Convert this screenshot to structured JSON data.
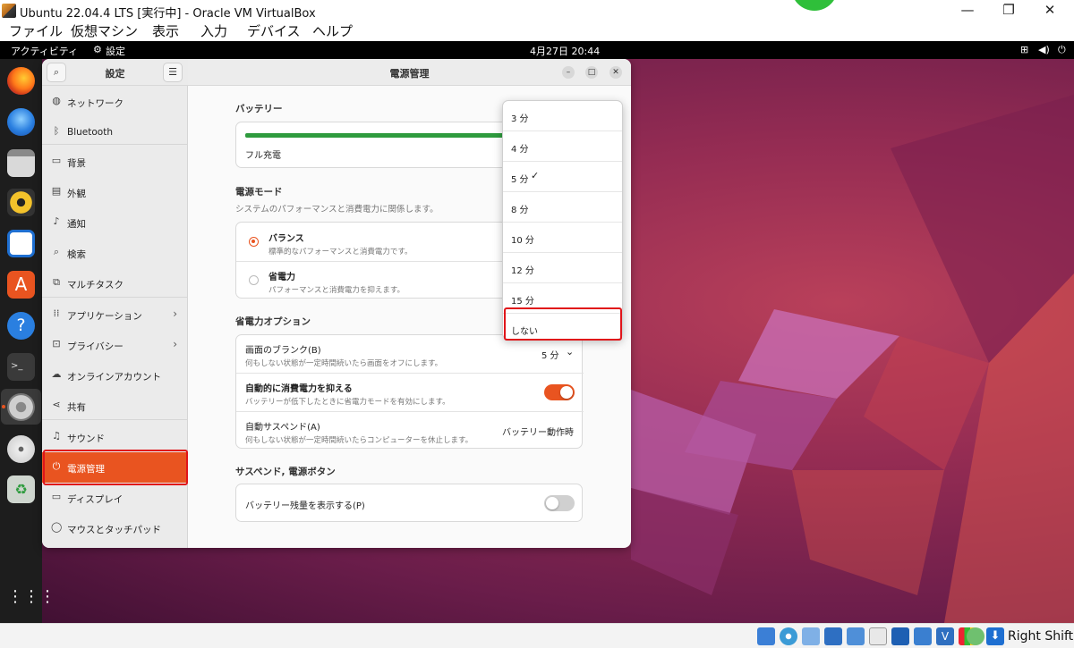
{
  "host": {
    "title": "Ubuntu 22.04.4 LTS [実行中] - Oracle VM VirtualBox",
    "menu": [
      "ファイル",
      "仮想マシン",
      "表示",
      "入力",
      "デバイス",
      "ヘルプ"
    ],
    "host_key": "Right Shift",
    "window_buttons": {
      "minimize": "—",
      "restore": "❐",
      "close": "✕"
    }
  },
  "topbar": {
    "activities": "アクティビティ",
    "app_name": "設定",
    "datetime": "4月27日  20:44",
    "tray_icons": [
      "network-icon",
      "volume-icon",
      "power-icon"
    ]
  },
  "dock": {
    "apps": [
      "firefox-icon",
      "thunderbird-icon",
      "files-icon",
      "rhythmbox-icon",
      "writer-icon",
      "app-center-icon",
      "help-icon",
      "terminal-icon",
      "settings-icon",
      "disc-icon",
      "trash-icon",
      "app-grid-icon"
    ]
  },
  "settings": {
    "sidebar_title": "設定",
    "window_title": "電源管理",
    "sidebar_items": [
      {
        "label": "ネットワーク",
        "icon": "globe-icon"
      },
      {
        "label": "Bluetooth",
        "icon": "bluetooth-icon"
      },
      {
        "label": "背景",
        "icon": "background-icon"
      },
      {
        "label": "外観",
        "icon": "appearance-icon"
      },
      {
        "label": "通知",
        "icon": "bell-icon"
      },
      {
        "label": "検索",
        "icon": "search-icon"
      },
      {
        "label": "マルチタスク",
        "icon": "multitask-icon"
      },
      {
        "label": "アプリケーション",
        "icon": "apps-grid-icon"
      },
      {
        "label": "プライバシー",
        "icon": "lock-icon"
      },
      {
        "label": "オンラインアカウント",
        "icon": "cloud-icon"
      },
      {
        "label": "共有",
        "icon": "share-icon"
      },
      {
        "label": "サウンド",
        "icon": "music-note-icon"
      },
      {
        "label": "電源管理",
        "icon": "power-icon"
      },
      {
        "label": "ディスプレイ",
        "icon": "display-icon"
      },
      {
        "label": "マウスとタッチパッド",
        "icon": "mouse-icon"
      }
    ],
    "battery": {
      "section_title": "バッテリー",
      "status": "フル充電",
      "level": 1.0
    },
    "power_mode": {
      "section_title": "電源モード",
      "subtitle": "システムのパフォーマンスと消費電力に関係します。",
      "options": [
        {
          "title": "バランス",
          "desc": "標準的なパフォーマンスと消費電力です。",
          "selected": true
        },
        {
          "title": "省電力",
          "desc": "パフォーマンスと消費電力を抑えます。",
          "selected": false
        }
      ]
    },
    "power_saving": {
      "section_title": "省電力オプション",
      "blank_screen": {
        "title": "画面のブランク(B)",
        "desc": "何もしない状態が一定時間続いたら画面をオフにします。",
        "value": "5 分"
      },
      "auto_power_saver": {
        "title": "自動的に消費電力を抑える",
        "desc": "バッテリーが低下したときに省電力モードを有効にします。",
        "on": true
      },
      "auto_suspend": {
        "title": "自動サスペンド(A)",
        "desc": "何もしない状態が一定時間続いたらコンピューターを休止します。",
        "value": "バッテリー動作時"
      }
    },
    "suspend_button": {
      "section_title": "サスペンド, 電源ボタン",
      "show_battery": {
        "title": "バッテリー残量を表示する(P)",
        "on": false
      }
    },
    "dropdown": {
      "options": [
        "3 分",
        "4 分",
        "5 分",
        "8 分",
        "10 分",
        "12 分",
        "15 分",
        "しない"
      ],
      "selected": "5 分",
      "check": "✓"
    }
  },
  "colors": {
    "accent": "#e95420",
    "highlight_box": "#e0151a",
    "vbox_green": "#2fbf3a"
  }
}
